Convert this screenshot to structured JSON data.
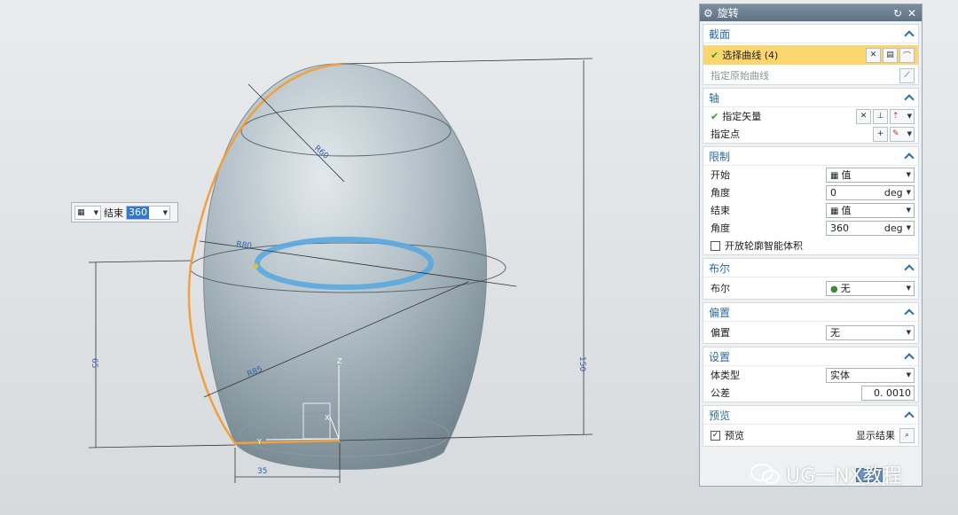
{
  "viewport": {
    "dimension_labels": {
      "top_radius": "R60",
      "mid_radius": "R80",
      "main_radius": "R85",
      "left_height": "65",
      "right_height": "150",
      "bottom_width": "35",
      "axis_z": "Z",
      "axis_y": "Y",
      "axis_x": "X"
    },
    "float_input": {
      "label": "结束",
      "value": "360"
    }
  },
  "panel": {
    "title": "旋转",
    "sections": {
      "section": {
        "title": "截面",
        "select_curve": "选择曲线 (4)",
        "specify_original": "指定原始曲线"
      },
      "axis": {
        "title": "轴",
        "specify_vector": "指定矢量",
        "specify_point": "指定点"
      },
      "limits": {
        "title": "限制",
        "start_label": "开始",
        "start_mode": "值",
        "start_angle_label": "角度",
        "start_angle": "0",
        "unit": "deg",
        "end_label": "结束",
        "end_mode": "值",
        "end_angle_label": "角度",
        "end_angle": "360",
        "open_profile": "开放轮廓智能体积"
      },
      "boolean": {
        "title": "布尔",
        "label": "布尔",
        "value": "无"
      },
      "offset": {
        "title": "偏置",
        "label": "偏置",
        "value": "无"
      },
      "settings": {
        "title": "设置",
        "body_type_label": "体类型",
        "body_type": "实体",
        "tolerance_label": "公差",
        "tolerance": "0. 0010"
      },
      "preview": {
        "title": "预览",
        "preview_label": "预览",
        "show_result": "显示结果"
      }
    }
  },
  "watermark": "UG一NX教程",
  "colors": {
    "accent": "#2f6aa8",
    "selected_row": "#fbd66e",
    "curve_orange": "#f0a040",
    "ring_blue": "#5aa9e0",
    "body": "#9aa9b3"
  }
}
